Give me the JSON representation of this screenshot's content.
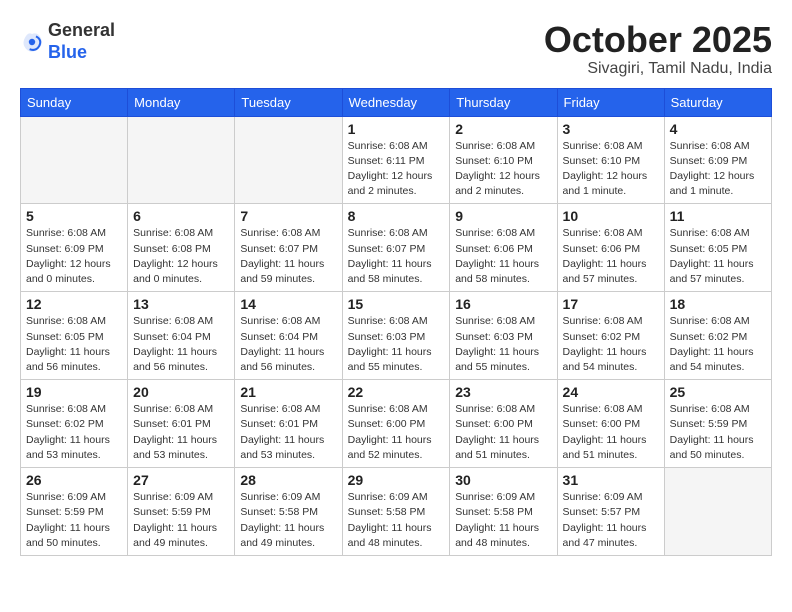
{
  "logo": {
    "general": "General",
    "blue": "Blue"
  },
  "header": {
    "month": "October 2025",
    "location": "Sivagiri, Tamil Nadu, India"
  },
  "weekdays": [
    "Sunday",
    "Monday",
    "Tuesday",
    "Wednesday",
    "Thursday",
    "Friday",
    "Saturday"
  ],
  "weeks": [
    [
      {
        "day": "",
        "info": ""
      },
      {
        "day": "",
        "info": ""
      },
      {
        "day": "",
        "info": ""
      },
      {
        "day": "1",
        "info": "Sunrise: 6:08 AM\nSunset: 6:11 PM\nDaylight: 12 hours and 2 minutes."
      },
      {
        "day": "2",
        "info": "Sunrise: 6:08 AM\nSunset: 6:10 PM\nDaylight: 12 hours and 2 minutes."
      },
      {
        "day": "3",
        "info": "Sunrise: 6:08 AM\nSunset: 6:10 PM\nDaylight: 12 hours and 1 minute."
      },
      {
        "day": "4",
        "info": "Sunrise: 6:08 AM\nSunset: 6:09 PM\nDaylight: 12 hours and 1 minute."
      }
    ],
    [
      {
        "day": "5",
        "info": "Sunrise: 6:08 AM\nSunset: 6:09 PM\nDaylight: 12 hours and 0 minutes."
      },
      {
        "day": "6",
        "info": "Sunrise: 6:08 AM\nSunset: 6:08 PM\nDaylight: 12 hours and 0 minutes."
      },
      {
        "day": "7",
        "info": "Sunrise: 6:08 AM\nSunset: 6:07 PM\nDaylight: 11 hours and 59 minutes."
      },
      {
        "day": "8",
        "info": "Sunrise: 6:08 AM\nSunset: 6:07 PM\nDaylight: 11 hours and 58 minutes."
      },
      {
        "day": "9",
        "info": "Sunrise: 6:08 AM\nSunset: 6:06 PM\nDaylight: 11 hours and 58 minutes."
      },
      {
        "day": "10",
        "info": "Sunrise: 6:08 AM\nSunset: 6:06 PM\nDaylight: 11 hours and 57 minutes."
      },
      {
        "day": "11",
        "info": "Sunrise: 6:08 AM\nSunset: 6:05 PM\nDaylight: 11 hours and 57 minutes."
      }
    ],
    [
      {
        "day": "12",
        "info": "Sunrise: 6:08 AM\nSunset: 6:05 PM\nDaylight: 11 hours and 56 minutes."
      },
      {
        "day": "13",
        "info": "Sunrise: 6:08 AM\nSunset: 6:04 PM\nDaylight: 11 hours and 56 minutes."
      },
      {
        "day": "14",
        "info": "Sunrise: 6:08 AM\nSunset: 6:04 PM\nDaylight: 11 hours and 56 minutes."
      },
      {
        "day": "15",
        "info": "Sunrise: 6:08 AM\nSunset: 6:03 PM\nDaylight: 11 hours and 55 minutes."
      },
      {
        "day": "16",
        "info": "Sunrise: 6:08 AM\nSunset: 6:03 PM\nDaylight: 11 hours and 55 minutes."
      },
      {
        "day": "17",
        "info": "Sunrise: 6:08 AM\nSunset: 6:02 PM\nDaylight: 11 hours and 54 minutes."
      },
      {
        "day": "18",
        "info": "Sunrise: 6:08 AM\nSunset: 6:02 PM\nDaylight: 11 hours and 54 minutes."
      }
    ],
    [
      {
        "day": "19",
        "info": "Sunrise: 6:08 AM\nSunset: 6:02 PM\nDaylight: 11 hours and 53 minutes."
      },
      {
        "day": "20",
        "info": "Sunrise: 6:08 AM\nSunset: 6:01 PM\nDaylight: 11 hours and 53 minutes."
      },
      {
        "day": "21",
        "info": "Sunrise: 6:08 AM\nSunset: 6:01 PM\nDaylight: 11 hours and 53 minutes."
      },
      {
        "day": "22",
        "info": "Sunrise: 6:08 AM\nSunset: 6:00 PM\nDaylight: 11 hours and 52 minutes."
      },
      {
        "day": "23",
        "info": "Sunrise: 6:08 AM\nSunset: 6:00 PM\nDaylight: 11 hours and 51 minutes."
      },
      {
        "day": "24",
        "info": "Sunrise: 6:08 AM\nSunset: 6:00 PM\nDaylight: 11 hours and 51 minutes."
      },
      {
        "day": "25",
        "info": "Sunrise: 6:08 AM\nSunset: 5:59 PM\nDaylight: 11 hours and 50 minutes."
      }
    ],
    [
      {
        "day": "26",
        "info": "Sunrise: 6:09 AM\nSunset: 5:59 PM\nDaylight: 11 hours and 50 minutes."
      },
      {
        "day": "27",
        "info": "Sunrise: 6:09 AM\nSunset: 5:59 PM\nDaylight: 11 hours and 49 minutes."
      },
      {
        "day": "28",
        "info": "Sunrise: 6:09 AM\nSunset: 5:58 PM\nDaylight: 11 hours and 49 minutes."
      },
      {
        "day": "29",
        "info": "Sunrise: 6:09 AM\nSunset: 5:58 PM\nDaylight: 11 hours and 48 minutes."
      },
      {
        "day": "30",
        "info": "Sunrise: 6:09 AM\nSunset: 5:58 PM\nDaylight: 11 hours and 48 minutes."
      },
      {
        "day": "31",
        "info": "Sunrise: 6:09 AM\nSunset: 5:57 PM\nDaylight: 11 hours and 47 minutes."
      },
      {
        "day": "",
        "info": ""
      }
    ]
  ]
}
